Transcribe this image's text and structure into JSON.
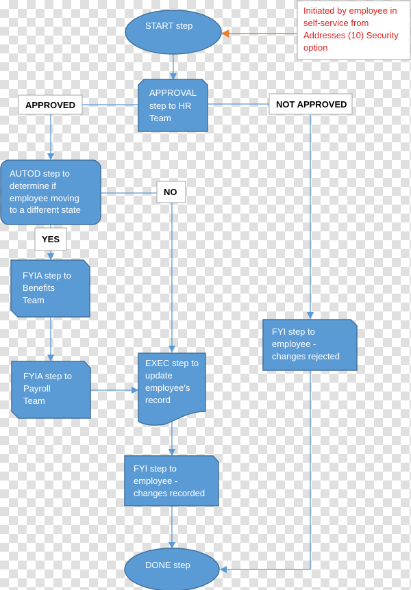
{
  "colors": {
    "shape_fill": "#5b9bd5",
    "shape_stroke": "#41719c",
    "connector": "#5b9bd5",
    "note_arrow": "#ed7d31",
    "note_text": "#e02020"
  },
  "note": {
    "lines": [
      "Initiated by employee in",
      "self-service from",
      "Addresses (10) Security",
      "option"
    ]
  },
  "nodes": {
    "start": {
      "lines": [
        "START step"
      ]
    },
    "approval": {
      "lines": [
        "APPROVAL",
        "step to HR",
        "Team"
      ]
    },
    "autod": {
      "lines": [
        "AUTOD step to",
        "determine if",
        "employee moving",
        "to a different state"
      ]
    },
    "fyia_benefits": {
      "lines": [
        "FYIA step to",
        "Benefits",
        "Team"
      ]
    },
    "fyia_payroll": {
      "lines": [
        "FYIA step to",
        "Payroll",
        "Team"
      ]
    },
    "exec": {
      "lines": [
        "EXEC step to",
        "update",
        "employee's",
        "record"
      ]
    },
    "fyi_recorded": {
      "lines": [
        "FYI step to",
        "employee -",
        "changes recorded"
      ]
    },
    "fyi_rejected": {
      "lines": [
        "FYI step to",
        "employee -",
        "changes rejected"
      ]
    },
    "done": {
      "lines": [
        "DONE step"
      ]
    }
  },
  "labels": {
    "approved": "APPROVED",
    "not_approved": "NOT APPROVED",
    "no": "NO",
    "yes": "YES"
  }
}
